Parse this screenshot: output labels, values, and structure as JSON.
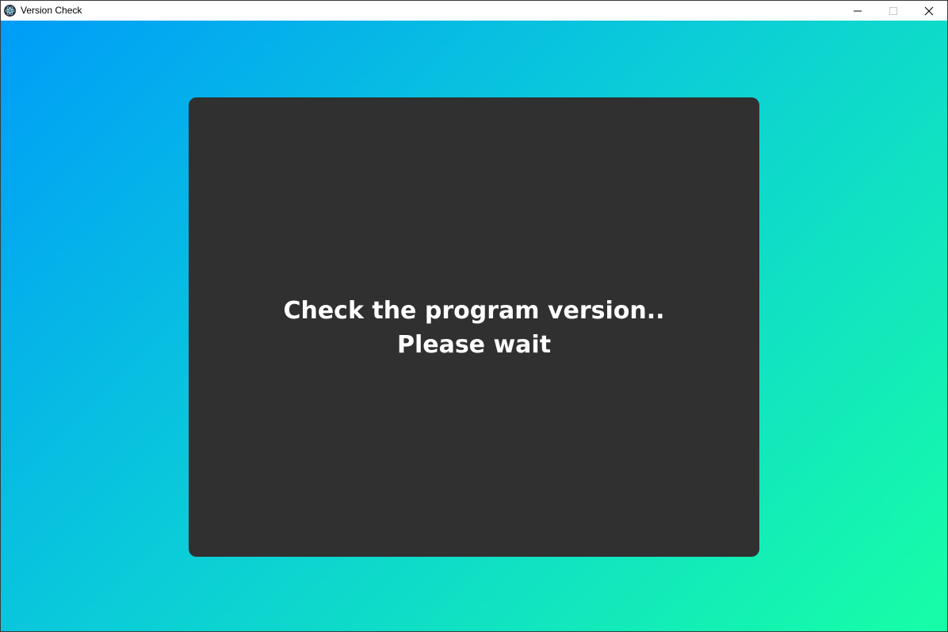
{
  "window": {
    "title": "Version Check",
    "icon": "electron-atom-icon",
    "controls": {
      "minimize_icon": "minimize-icon",
      "maximize_icon": "maximize-icon",
      "close_icon": "close-icon"
    }
  },
  "main": {
    "message_line1": "Check the program version..",
    "message_line2": "Please wait"
  },
  "colors": {
    "gradient_start": "#009df8",
    "gradient_end": "#17fea6",
    "card_background": "#303030",
    "text": "#ffffff"
  }
}
